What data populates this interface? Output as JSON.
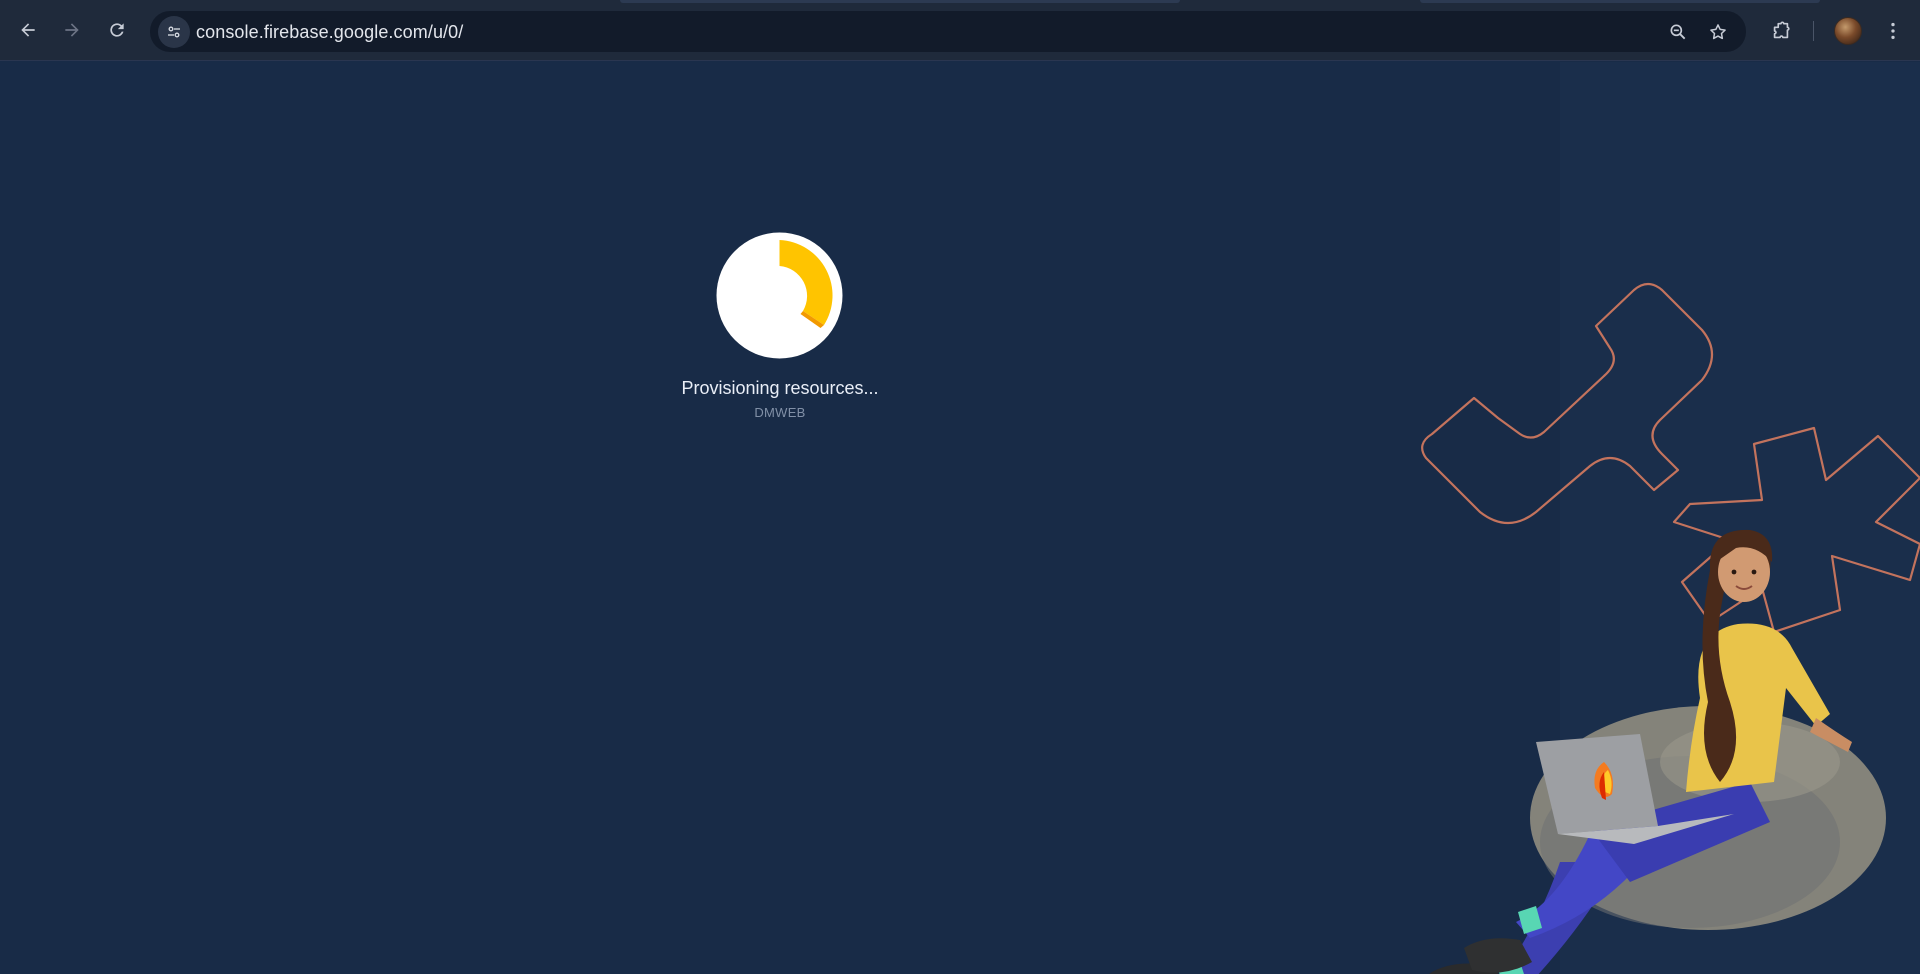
{
  "browser": {
    "url": "console.firebase.google.com/u/0/",
    "icons": {
      "back": "arrow-left-icon",
      "forward": "arrow-right-icon",
      "reload": "reload-icon",
      "site_info": "tune-icon",
      "zoom": "zoom-out-icon",
      "bookmark": "star-icon",
      "extensions": "puzzle-icon",
      "menu": "kebab-menu-icon"
    }
  },
  "loader": {
    "status_text": "Provisioning resources...",
    "project_name": "DMWEB",
    "accent_color": "#ffc400"
  },
  "theme": {
    "background": "#182b47",
    "toolbar": "#1f2a3b",
    "outline_accent": "#c3735d"
  }
}
